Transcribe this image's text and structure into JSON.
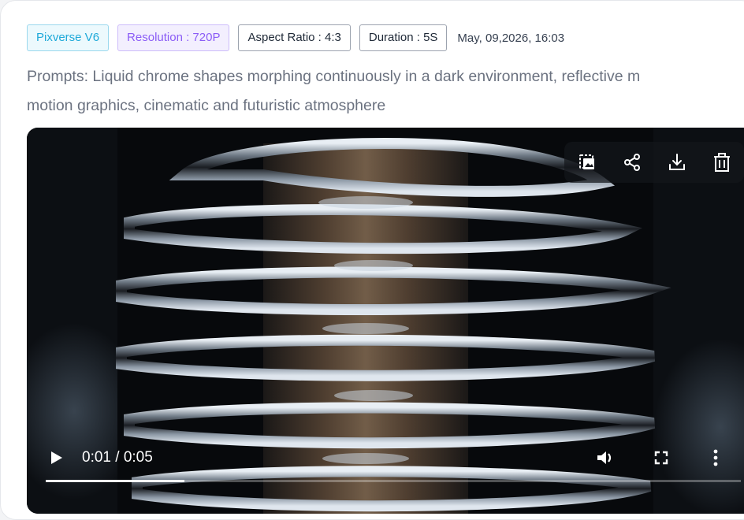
{
  "tags": {
    "model": "Pixverse V6",
    "resolution": "Resolution : 720P",
    "aspect_ratio": "Aspect Ratio : 4:3",
    "duration": "Duration : 5S",
    "date": "May, 09,2026, 16:03"
  },
  "prompt": {
    "line1": "Prompts: Liquid chrome shapes morphing continuously in a dark environment, reflective m",
    "line2": "motion graphics, cinematic and futuristic atmosphere"
  },
  "video": {
    "time_display": "0:01 / 0:05",
    "progress_fraction": 0.2,
    "toolbar_icons": [
      "image-export-icon",
      "share-icon",
      "download-icon",
      "trash-icon"
    ],
    "control_icons": [
      "play-icon",
      "volume-icon",
      "fullscreen-icon",
      "more-vertical-icon"
    ]
  },
  "colors": {
    "model_tag": "#1ea9d9",
    "resolution_tag": "#8b5cf6",
    "prompt_text": "#6b7280"
  }
}
